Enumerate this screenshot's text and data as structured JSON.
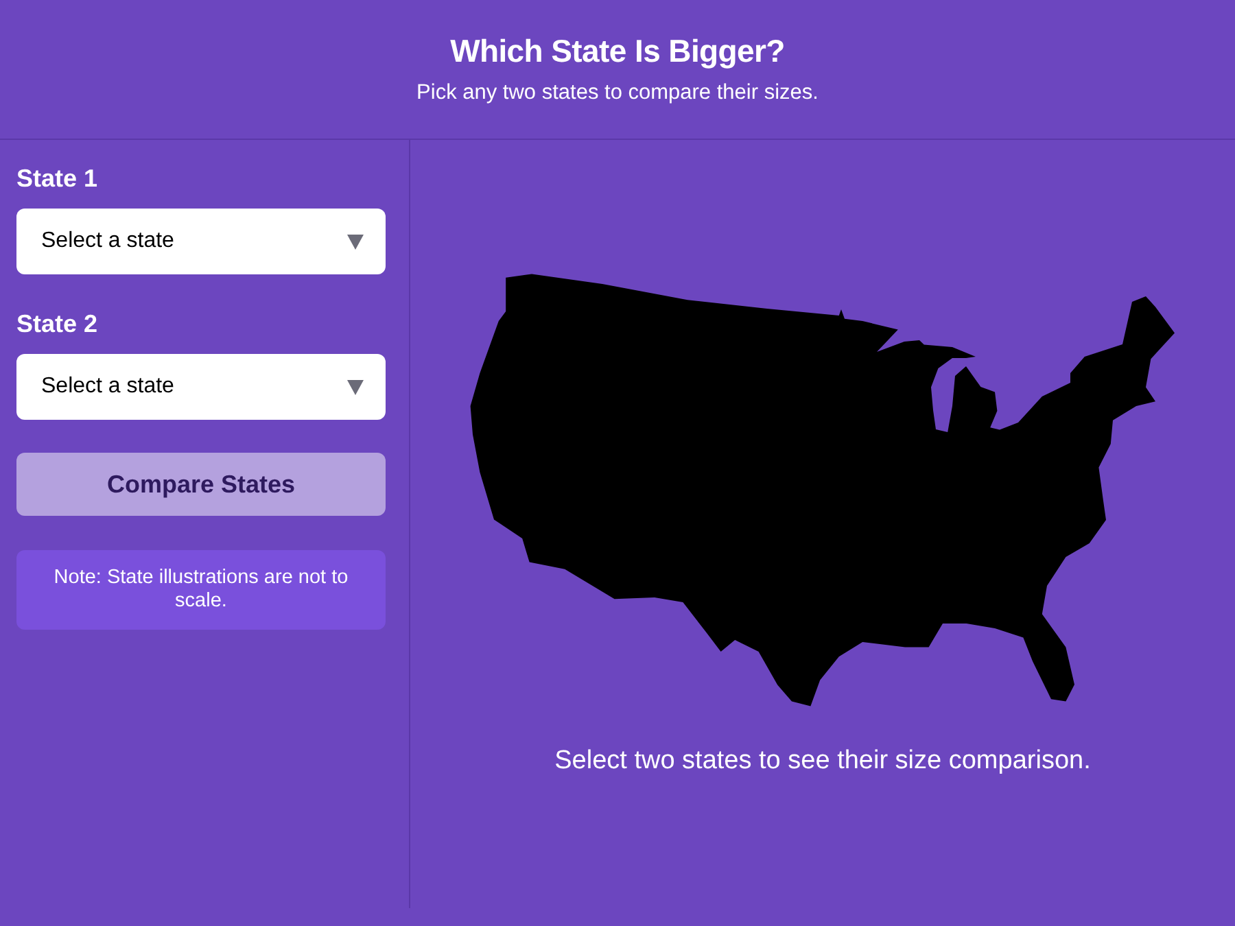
{
  "header": {
    "title": "Which State Is Bigger?",
    "subtitle": "Pick any two states to compare their sizes."
  },
  "sidebar": {
    "fields": [
      {
        "label": "State 1",
        "placeholder": "Select a state"
      },
      {
        "label": "State 2",
        "placeholder": "Select a state"
      }
    ],
    "compare_button": {
      "label": "Compare States",
      "disabled": true
    },
    "note": "Note: State illustrations are not to scale."
  },
  "main": {
    "message": "Select two states to see their size comparison."
  }
}
